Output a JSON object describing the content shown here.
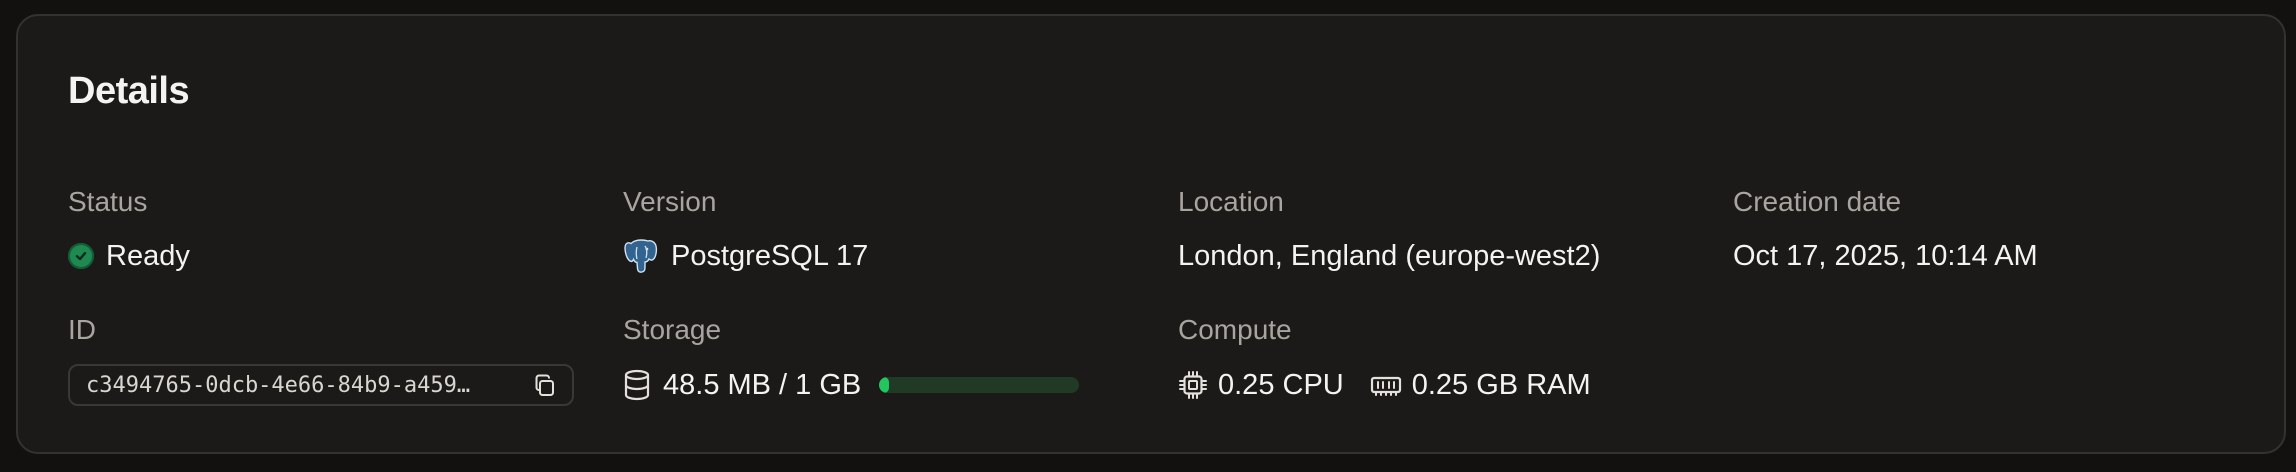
{
  "details": {
    "title": "Details",
    "status": {
      "label": "Status",
      "value": "Ready"
    },
    "version": {
      "label": "Version",
      "value": "PostgreSQL 17"
    },
    "location": {
      "label": "Location",
      "value": "London, England (europe-west2)"
    },
    "creation_date": {
      "label": "Creation date",
      "value": "Oct 17, 2025, 10:14 AM"
    },
    "id": {
      "label": "ID",
      "value": "c3494765-0dcb-4e66-84b9-a459…"
    },
    "storage": {
      "label": "Storage",
      "value": "48.5 MB / 1 GB",
      "used_fraction": 0.0485
    },
    "compute": {
      "label": "Compute",
      "cpu": "0.25 CPU",
      "ram": "0.25 GB RAM"
    }
  },
  "icons": {
    "status": "check-circle-icon",
    "version": "postgresql-elephant-icon",
    "copy": "copy-icon",
    "storage": "database-icon",
    "cpu": "cpu-chip-icon",
    "ram": "memory-icon"
  },
  "colors": {
    "status_ready": "#1e8a52",
    "storage_fill": "#22c55e",
    "storage_track": "#213a26"
  }
}
